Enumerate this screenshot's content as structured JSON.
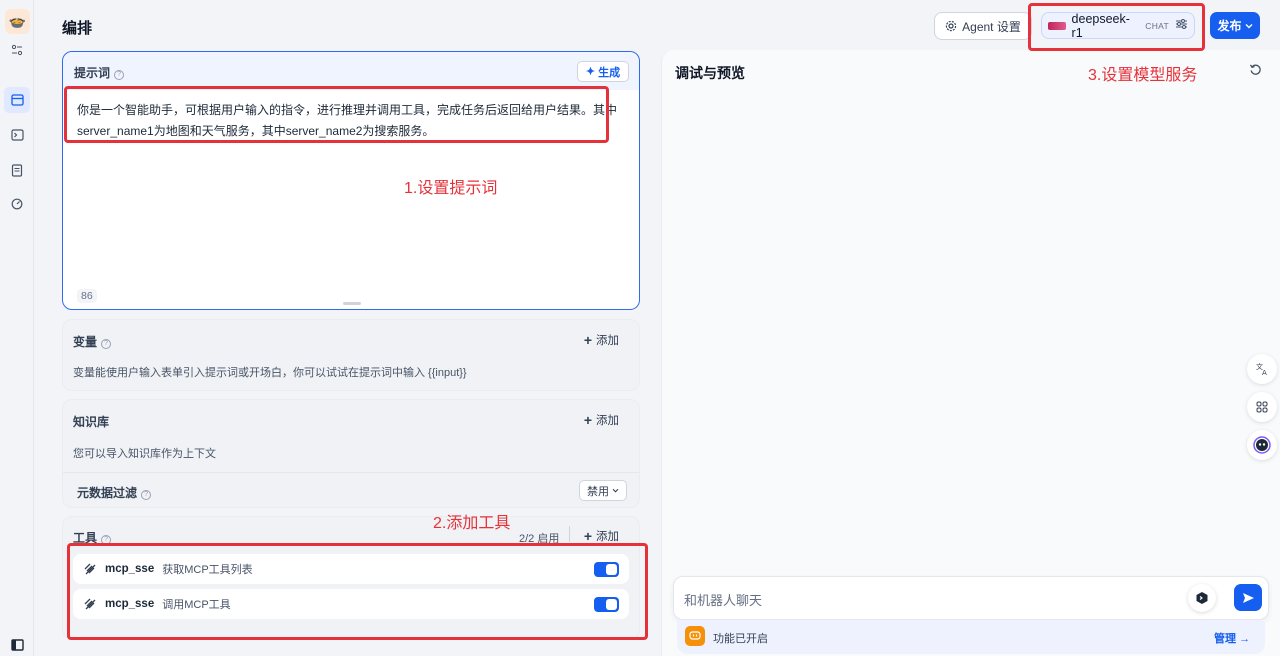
{
  "header": {
    "title": "编排",
    "agent_settings_label": "Agent 设置",
    "model_name": "deepseek-r1",
    "model_tag": "CHAT",
    "publish_label": "发布"
  },
  "prompt": {
    "title": "提示词",
    "generate_label": "生成",
    "text": "你是一个智能助手，可根据用户输入的指令，进行推理并调用工具，完成任务后返回给用户结果。其中server_name1为地图和天气服务，其中server_name2为搜索服务。",
    "char_count": "86"
  },
  "variables": {
    "title": "变量",
    "add_label": "添加",
    "description": "变量能使用户输入表单引入提示词或开场白，你可以试试在提示词中输入 {{input}}"
  },
  "knowledge": {
    "title": "知识库",
    "add_label": "添加",
    "description": "您可以导入知识库作为上下文",
    "metadata_filter_label": "元数据过滤",
    "metadata_filter_value": "禁用"
  },
  "tools": {
    "title": "工具",
    "enabled_count": "2/2 启用",
    "add_label": "添加",
    "items": [
      {
        "name": "mcp_sse",
        "description": "获取MCP工具列表",
        "enabled": true
      },
      {
        "name": "mcp_sse",
        "description": "调用MCP工具",
        "enabled": true
      }
    ]
  },
  "preview": {
    "title": "调试与预览",
    "chat_placeholder": "和机器人聊天",
    "feature_status": "功能已开启",
    "manage_label": "管理"
  },
  "annotations": {
    "step1": "1.设置提示词",
    "step2": "2.添加工具",
    "step3": "3.设置模型服务"
  },
  "colors": {
    "accent": "#155eef",
    "annotation_red": "#e5323a"
  }
}
